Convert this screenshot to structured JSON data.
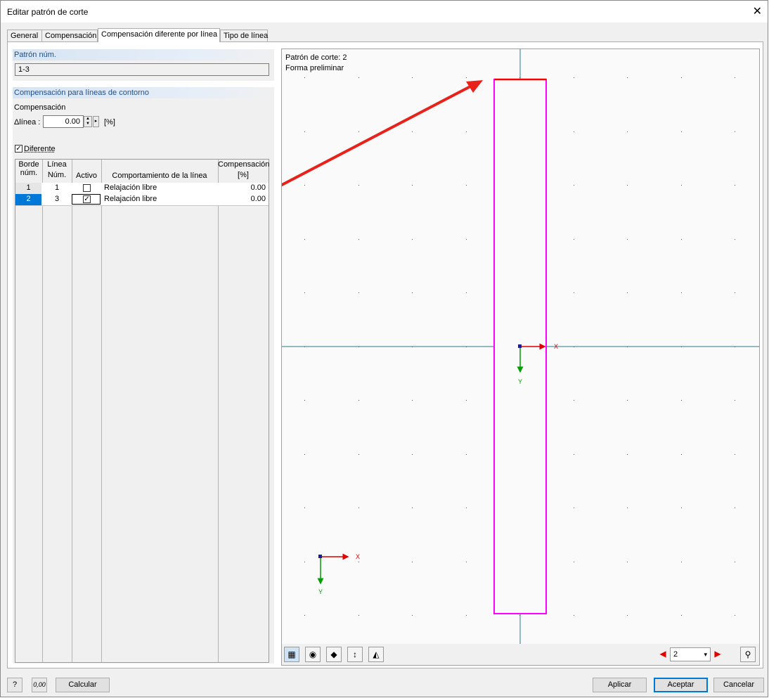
{
  "window": {
    "title": "Editar patrón de corte",
    "close_glyph": "✕"
  },
  "tabs": [
    {
      "label": "General"
    },
    {
      "label": "Compensación"
    },
    {
      "label": "Compensación diferente por línea"
    },
    {
      "label": "Tipo de línea"
    }
  ],
  "pattern": {
    "header": "Patrón núm.",
    "value": "1-3"
  },
  "contour": {
    "header": "Compensación para líneas de contorno",
    "comp_label": "Compensación",
    "delta_label": "Δlínea :",
    "delta_value": "0.00",
    "unit": "[%]",
    "different_label": "Diferente",
    "different_checked": true
  },
  "table": {
    "headers": {
      "borde": [
        "Borde",
        "núm."
      ],
      "linea": [
        "Línea",
        "Núm."
      ],
      "activo": "Activo",
      "comportamiento": "Comportamiento de la línea",
      "compensacion": [
        "Compensación",
        "[%]"
      ]
    },
    "rows": [
      {
        "borde": "1",
        "linea": "1",
        "activo": false,
        "comportamiento": "Relajación libre",
        "compensacion": "0.00"
      },
      {
        "borde": "2",
        "linea": "3",
        "activo": true,
        "comportamiento": "Relajación libre",
        "compensacion": "0.00"
      }
    ]
  },
  "preview": {
    "line1": "Patrón de corte: 2",
    "line2": "Forma preliminar",
    "axis_x": "X",
    "axis_y": "Y",
    "pattern_selected": "2",
    "outline_color": "#ff00ff",
    "edge_color": "#ff0000",
    "arrow_color": "#e8221a"
  },
  "toolbar_icons": [
    "display-icon",
    "view-icon",
    "surface-icon",
    "dimension-icon",
    "mirror-icon"
  ],
  "footer": {
    "calc_label": "Calcular",
    "apply_label": "Aplicar",
    "ok_label": "Aceptar",
    "cancel_label": "Cancelar",
    "help_icon": "?",
    "units_icon": "0,00"
  }
}
